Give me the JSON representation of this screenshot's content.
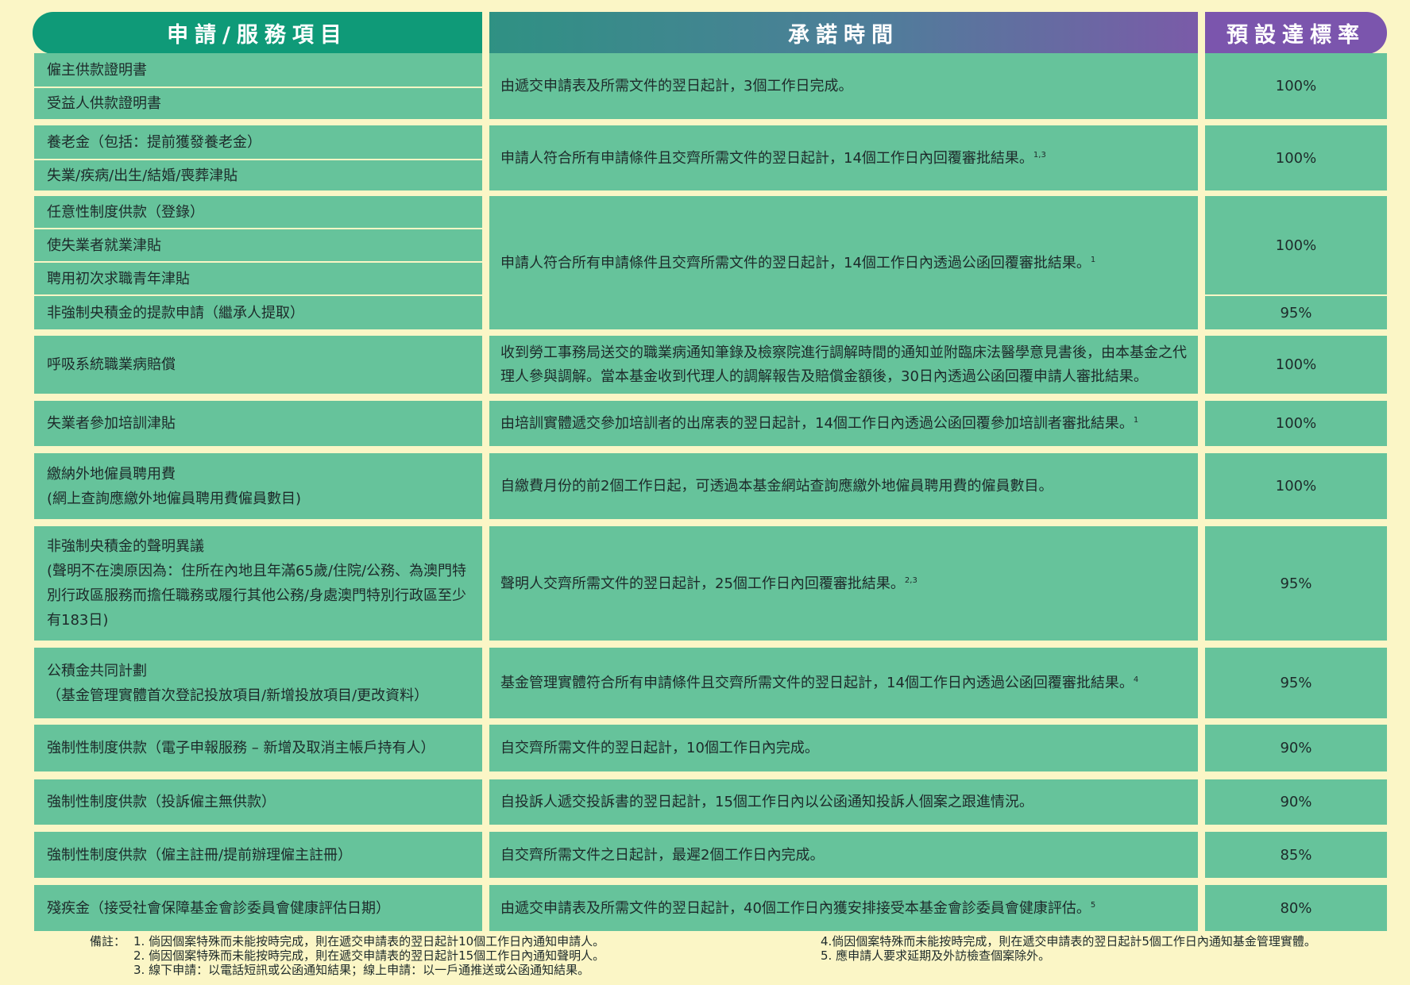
{
  "header": {
    "col1": "申請/服務項目",
    "col2": "承諾時間",
    "col3": "預設達標率"
  },
  "rows": [
    {
      "items": [
        "僱主供款證明書",
        "受益人供款證明書"
      ],
      "time": "由遞交申請表及所需文件的翌日起計，3個工作日完成。",
      "rate": "100%"
    },
    {
      "items": [
        "養老金（包括：提前獲發養老金）",
        "失業/疾病/出生/結婚/喪葬津貼"
      ],
      "time": "申請人符合所有申請條件且交齊所需文件的翌日起計，14個工作日內回覆審批結果。",
      "sup": "1,3",
      "rate": "100%"
    },
    {
      "items": [
        "任意性制度供款（登錄）",
        "使失業者就業津貼",
        "聘用初次求職青年津貼",
        "非強制央積金的提款申請（繼承人提取）"
      ],
      "time": "申請人符合所有申請條件且交齊所需文件的翌日起計，14個工作日內透過公函回覆審批結果。",
      "sup": "1",
      "rate": "100%",
      "rate2": "95%"
    },
    {
      "items": [
        "呼吸系統職業病賠償"
      ],
      "time": "收到勞工事務局送交的職業病通知筆錄及檢察院進行調解時間的通知並附臨床法醫學意見書後，由本基金之代理人參與調解。當本基金收到代理人的調解報告及賠償金額後，30日內透過公函回覆申請人審批結果。",
      "rate": "100%"
    },
    {
      "items": [
        "失業者參加培訓津貼"
      ],
      "time": "由培訓實體遞交參加培訓者的出席表的翌日起計，14個工作日內透過公函回覆參加培訓者審批結果。",
      "sup": "1",
      "rate": "100%"
    },
    {
      "items": [
        "繳納外地僱員聘用費",
        "(網上查詢應繳外地僱員聘用費僱員數目)"
      ],
      "time": "自繳費月份的前2個工作日起，可透過本基金網站查詢應繳外地僱員聘用費的僱員數目。",
      "rate": "100%"
    },
    {
      "items": [
        "非強制央積金的聲明異議",
        "(聲明不在澳原因為：住所在內地且年滿65歲/住院/公務、為澳門特別行政區服務而擔任職務或履行其他公務/身處澳門特別行政區至少有183日)"
      ],
      "time": "聲明人交齊所需文件的翌日起計，25個工作日內回覆審批結果。",
      "sup": "2,3",
      "rate": "95%"
    },
    {
      "items": [
        "公積金共同計劃",
        "（基金管理實體首次登記投放項目/新增投放項目/更改資料）"
      ],
      "time": "基金管理實體符合所有申請條件且交齊所需文件的翌日起計，14個工作日內透過公函回覆審批結果。",
      "sup": "4",
      "rate": "95%"
    },
    {
      "items": [
        "強制性制度供款（電子申報服務 – 新增及取消主帳戶持有人）"
      ],
      "time": "自交齊所需文件的翌日起計，10個工作日內完成。",
      "rate": "90%"
    },
    {
      "items": [
        "強制性制度供款（投訴僱主無供款）"
      ],
      "time": "自投訴人遞交投訴書的翌日起計，15個工作日內以公函通知投訴人個案之跟進情況。",
      "rate": "90%"
    },
    {
      "items": [
        "強制性制度供款（僱主註冊/提前辦理僱主註冊）"
      ],
      "time": "自交齊所需文件之日起計，最遲2個工作日內完成。",
      "rate": "85%"
    },
    {
      "items": [
        "殘疾金（接受社會保障基金會診委員會健康評估日期）"
      ],
      "time": "由遞交申請表及所需文件的翌日起計，40個工作日內獲安排接受本基金會診委員會健康評估。",
      "sup": "5",
      "rate": "80%"
    }
  ],
  "notes": {
    "label": "備註：",
    "n1": "1. 倘因個案特殊而未能按時完成，則在遞交申請表的翌日起計10個工作日內通知申請人。",
    "n2": "2. 倘因個案特殊而未能按時完成，則在遞交申請表的翌日起計15個工作日內通知聲明人。",
    "n3": "3. 線下申請：以電話短訊或公函通知結果；線上申請：以一戶通推送或公函通知結果。",
    "n4": "4.倘因個案特殊而未能按時完成，則在遞交申請表的翌日起計5個工作日內通知基金管理實體。",
    "n5": "5. 應申請人要求延期及外訪檢查個案除外。"
  },
  "colors": {
    "background": "#fbf6c6",
    "cell": "#66c39b",
    "header_left": "#0f9a78",
    "header_right": "#7b55ad"
  }
}
